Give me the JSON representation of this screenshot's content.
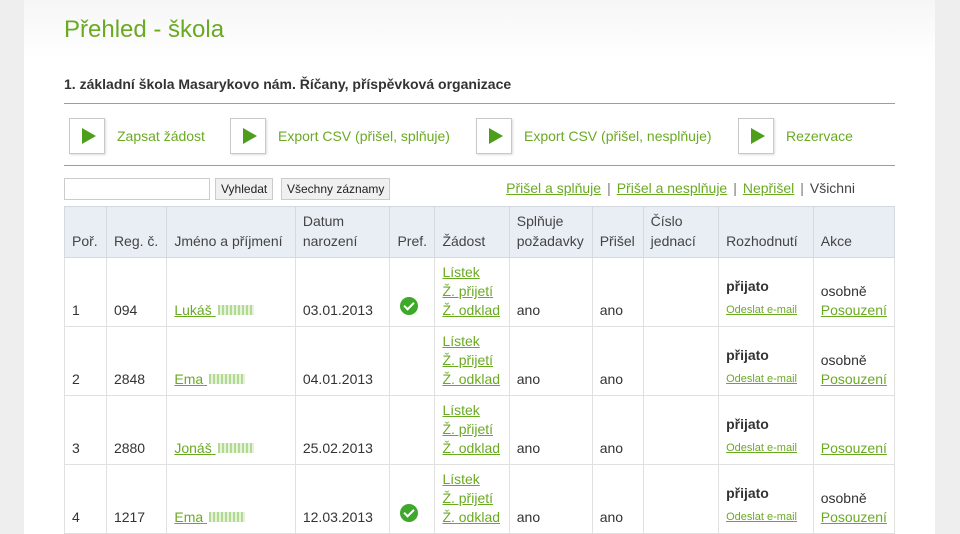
{
  "page": {
    "title": "Přehled - škola",
    "school_name": "1. základní škola Masarykovo nám. Říčany, příspěvková organizace"
  },
  "actions": [
    {
      "label": "Zapsat žádost"
    },
    {
      "label": "Export CSV (přišel, splňuje)"
    },
    {
      "label": "Export CSV (přišel, nesplňuje)"
    },
    {
      "label": "Rezervace"
    }
  ],
  "search": {
    "input_value": "",
    "search_button": "Vyhledat",
    "all_records_button": "Všechny záznamy"
  },
  "filters": {
    "f1": "Přišel a splňuje",
    "f2": "Přišel a nesplňuje",
    "f3": "Nepřišel",
    "f4": "Všichni",
    "separator": "|"
  },
  "table": {
    "headers": {
      "order": "Poř.",
      "reg": "Reg. č.",
      "name": "Jméno a příjmení",
      "birth": "Datum narození",
      "pref": "Pref.",
      "request": "Žádost",
      "meets": "Splňuje požadavky",
      "came": "Přišel",
      "ref": "Číslo jednací",
      "decision": "Rozhodnutí",
      "action": "Akce"
    },
    "link_labels": {
      "listek": "Lístek",
      "prijeti": "Ž. přijetí",
      "odklad": "Ž. odklad",
      "send_email": "Odeslat e-mail",
      "assessment": "Posouzení"
    },
    "rows": [
      {
        "order": "1",
        "reg": "094",
        "name": "Lukáš",
        "birth": "03.01.2013",
        "pref": true,
        "meets": "ano",
        "came": "ano",
        "ref": "",
        "decision": "přijato",
        "action_text": "osobně"
      },
      {
        "order": "2",
        "reg": "2848",
        "name": "Ema",
        "birth": "04.01.2013",
        "pref": false,
        "meets": "ano",
        "came": "ano",
        "ref": "",
        "decision": "přijato",
        "action_text": "osobně"
      },
      {
        "order": "3",
        "reg": "2880",
        "name": "Jonáš",
        "birth": "25.02.2013",
        "pref": false,
        "meets": "ano",
        "came": "ano",
        "ref": "",
        "decision": "přijato",
        "action_text": ""
      },
      {
        "order": "4",
        "reg": "1217",
        "name": "Ema",
        "birth": "12.03.2013",
        "pref": true,
        "meets": "ano",
        "came": "ano",
        "ref": "",
        "decision": "přijato",
        "action_text": "osobně"
      }
    ]
  },
  "colors": {
    "accent": "#6aaa23",
    "header_bg": "#e9eef4",
    "check_icon": "#3ea82a"
  },
  "icons": {
    "action_button": "play-icon",
    "preference": "check-circle-icon"
  }
}
